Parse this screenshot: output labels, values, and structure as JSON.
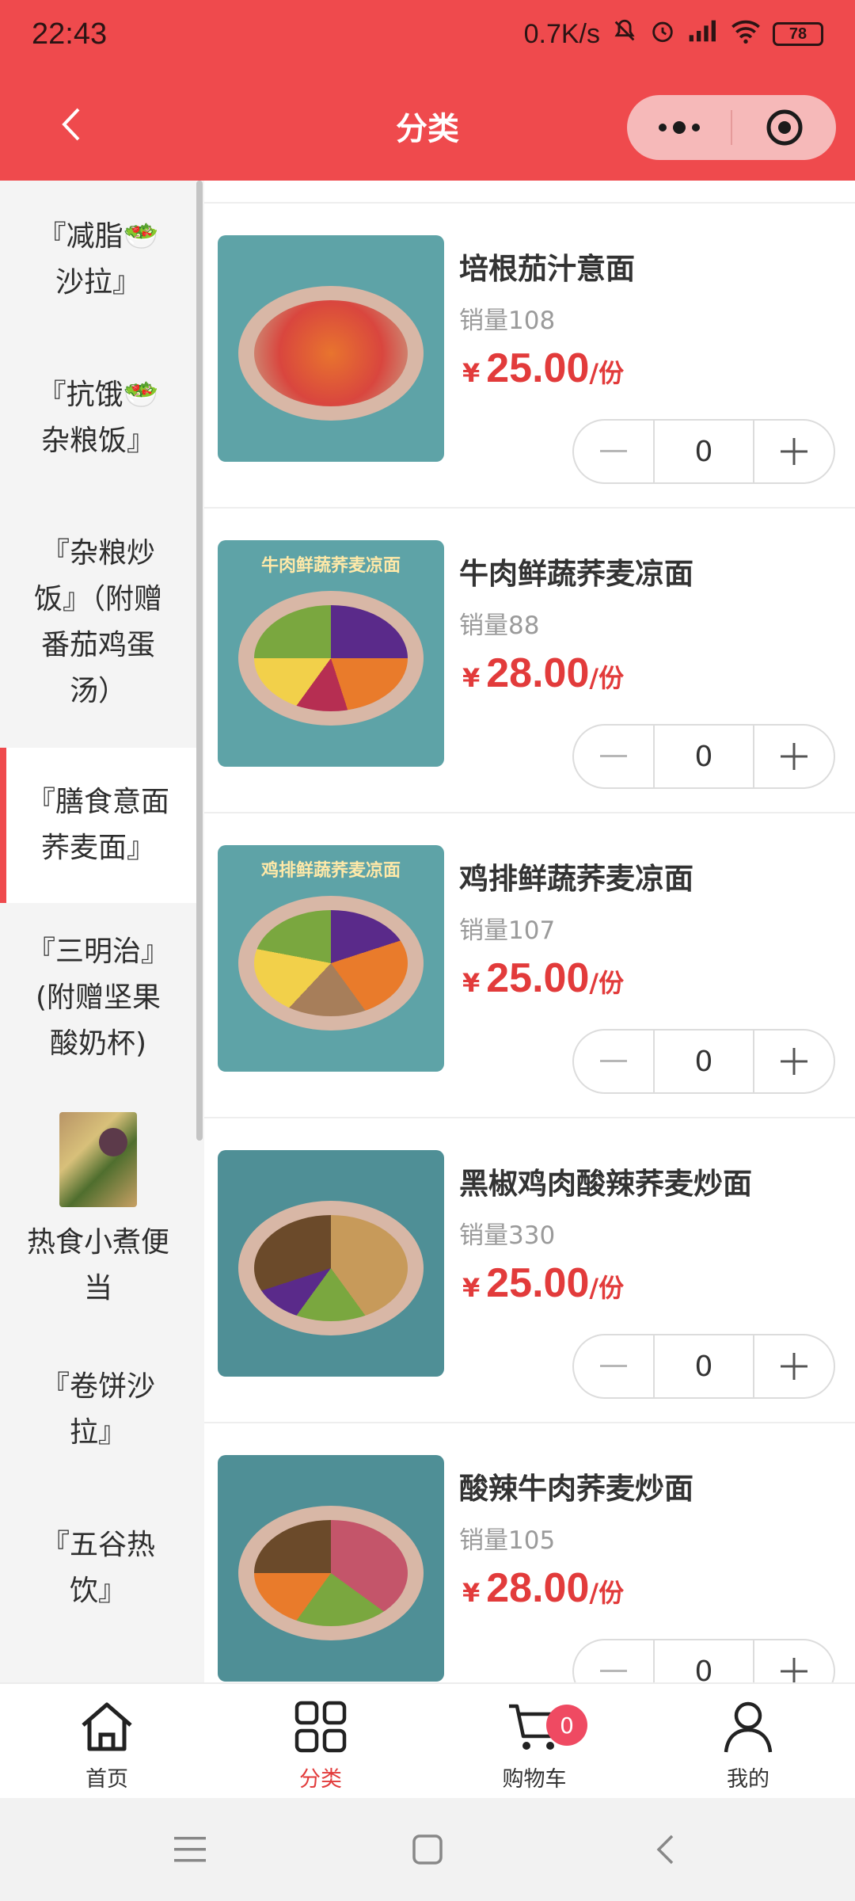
{
  "status_bar": {
    "time": "22:43",
    "network_speed": "0.7K/s",
    "battery": "78"
  },
  "header": {
    "title": "分类"
  },
  "sidebar": {
    "categories": [
      {
        "label": "『减脂🥗\n沙拉』"
      },
      {
        "label": "『抗饿🥗\n杂粮饭』"
      },
      {
        "label": "『杂粮炒\n饭』（附赠\n番茄鸡蛋\n汤）"
      },
      {
        "label": "『膳食意面\n荞麦面』"
      },
      {
        "label": "『三明治』\n(附赠坚果\n酸奶杯)"
      },
      {
        "label": "热食小煮便\n当"
      },
      {
        "label": "『卷饼沙\n拉』"
      },
      {
        "label": "『五谷热\n饮』"
      }
    ]
  },
  "products": [
    {
      "name": "培根茄汁意面",
      "sales": "销量108",
      "currency": "¥",
      "price": "25.00",
      "unit": "/份",
      "qty": "0",
      "caption": ""
    },
    {
      "name": "牛肉鲜蔬荞麦凉面",
      "sales": "销量88",
      "currency": "¥",
      "price": "28.00",
      "unit": "/份",
      "qty": "0",
      "caption": "牛肉鲜蔬荞麦凉面"
    },
    {
      "name": "鸡排鲜蔬荞麦凉面",
      "sales": "销量107",
      "currency": "¥",
      "price": "25.00",
      "unit": "/份",
      "qty": "0",
      "caption": "鸡排鲜蔬荞麦凉面"
    },
    {
      "name": "黑椒鸡肉酸辣荞麦炒面",
      "sales": "销量330",
      "currency": "¥",
      "price": "25.00",
      "unit": "/份",
      "qty": "0",
      "caption": ""
    },
    {
      "name": "酸辣牛肉荞麦炒面",
      "sales": "销量105",
      "currency": "¥",
      "price": "28.00",
      "unit": "/份",
      "qty": "0",
      "caption": ""
    }
  ],
  "tabbar": {
    "home": "首页",
    "category": "分类",
    "cart": "购物车",
    "cart_count": "0",
    "mine": "我的"
  },
  "colors": {
    "brand": "#ef4a4d",
    "price": "#e23b3b"
  }
}
